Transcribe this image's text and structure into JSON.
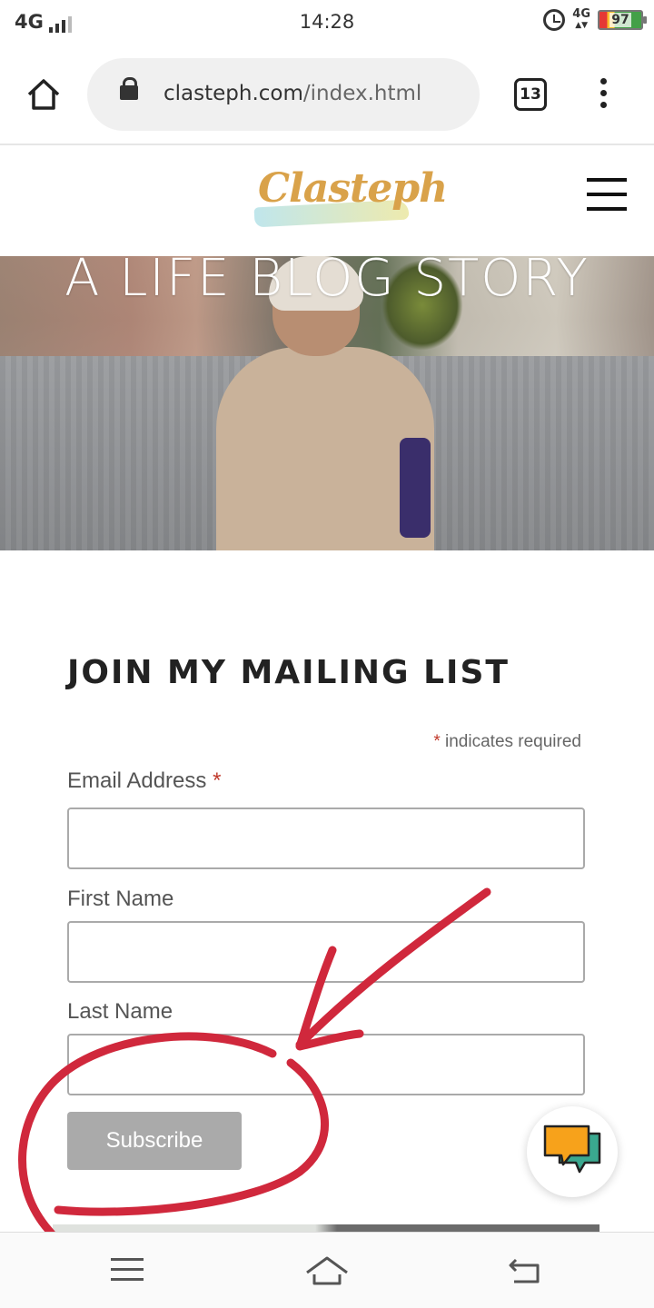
{
  "status_bar": {
    "network": "4G",
    "time": "14:28",
    "net_type": "4G",
    "battery": "97"
  },
  "browser": {
    "url_domain": "clasteph.com",
    "url_path": "/index.html",
    "tab_count": "13"
  },
  "site": {
    "logo_text": "Clasteph",
    "hero_title": "A LIFE BLOG STORY"
  },
  "form": {
    "title": "JOIN MY MAILING LIST",
    "required_star": "*",
    "required_note": "indicates required",
    "email_label": "Email Address",
    "first_name_label": "First Name",
    "last_name_label": "Last Name",
    "subscribe_label": "Subscribe"
  },
  "colors": {
    "accent_red": "#c0392b",
    "annotation_red": "#d0283c",
    "button_gray": "#aaaaaa",
    "logo_gold": "#d9a24a"
  },
  "icons": [
    "home-icon",
    "lock-icon",
    "tabs-icon",
    "more-icon",
    "menu-icon",
    "chat-icon",
    "nav-menu-icon",
    "nav-home-icon",
    "nav-back-icon"
  ]
}
